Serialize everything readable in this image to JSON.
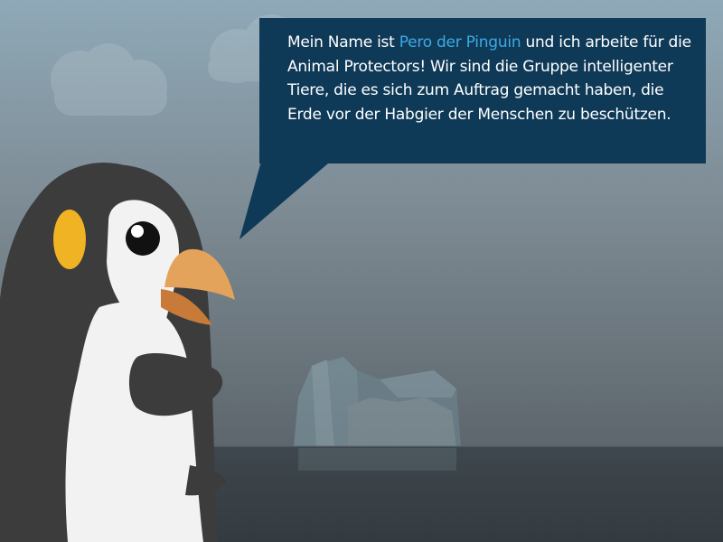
{
  "speech_bubble": {
    "text_before": "Mein Name ist ",
    "character_name": "Pero der Pinguin",
    "text_after": " und ich arbeite für die Animal Protectors! Wir sind die Gruppe intelligenter Tiere, die es sich zum Auftrag gemacht haben, die Erde vor der Habgier der Menschen zu beschützen.",
    "background_color": "#0f3a57",
    "highlight_color": "#3ea9e6",
    "text_color": "#ffffff"
  },
  "scene": {
    "sky_top_color": "#8fa7b6",
    "sky_bottom_color": "#5f6a72",
    "water_color": "#3a4247",
    "character": "penguin",
    "background_objects": [
      "clouds",
      "iceberg",
      "sea"
    ],
    "colors": {
      "penguin_body": "#3d3d3d",
      "penguin_belly": "#f2f2f2",
      "penguin_cheek": "#f0b323",
      "beak_upper": "#e4a35a",
      "beak_lower": "#c87a38"
    }
  }
}
